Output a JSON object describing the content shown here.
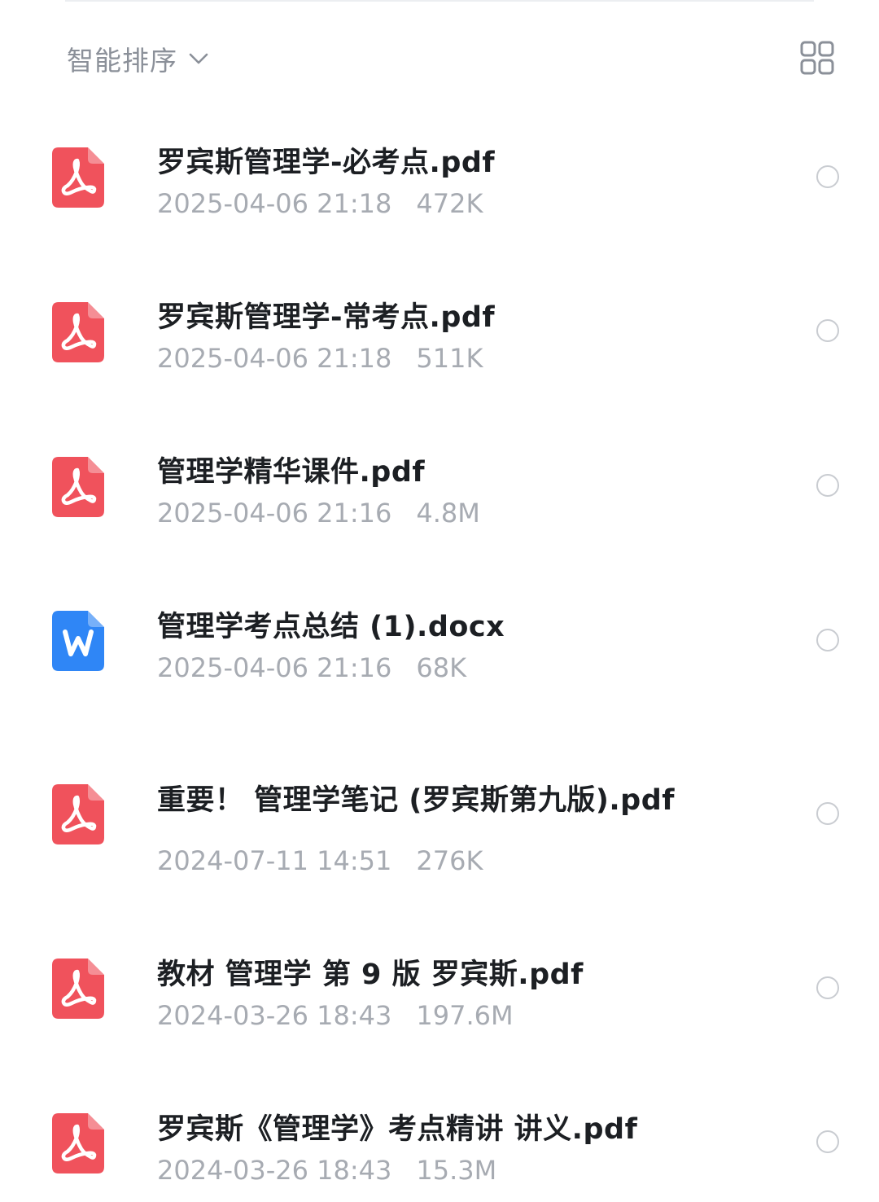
{
  "sort": {
    "label": "智能排序"
  },
  "icons": {
    "sort_chevron": "chevron-down-icon",
    "view_toggle": "grid-view-icon",
    "pdf": "pdf-file-icon",
    "word": "word-file-icon"
  },
  "colors": {
    "pdf_icon": "#f0525c",
    "word_icon": "#2f86f6"
  },
  "files": [
    {
      "name": "罗宾斯管理学-必考点.pdf",
      "date": "2025-04-06 21:18",
      "size": "472K",
      "type": "pdf"
    },
    {
      "name": "罗宾斯管理学-常考点.pdf",
      "date": "2025-04-06 21:18",
      "size": "511K",
      "type": "pdf"
    },
    {
      "name": "管理学精华课件.pdf",
      "date": "2025-04-06 21:16",
      "size": "4.8M",
      "type": "pdf"
    },
    {
      "name": "管理学考点总结 (1).docx",
      "date": "2025-04-06 21:16",
      "size": "68K",
      "type": "docx"
    },
    {
      "name": "重要！ 管理学笔记 (罗宾斯第九版).pdf",
      "date": "2024-07-11 14:51",
      "size": "276K",
      "type": "pdf"
    },
    {
      "name": "教材 管理学 第 9 版 罗宾斯.pdf",
      "date": "2024-03-26 18:43",
      "size": "197.6M",
      "type": "pdf"
    },
    {
      "name": "罗宾斯《管理学》考点精讲 讲义.pdf",
      "date": "2024-03-26 18:43",
      "size": "15.3M",
      "type": "pdf"
    }
  ]
}
